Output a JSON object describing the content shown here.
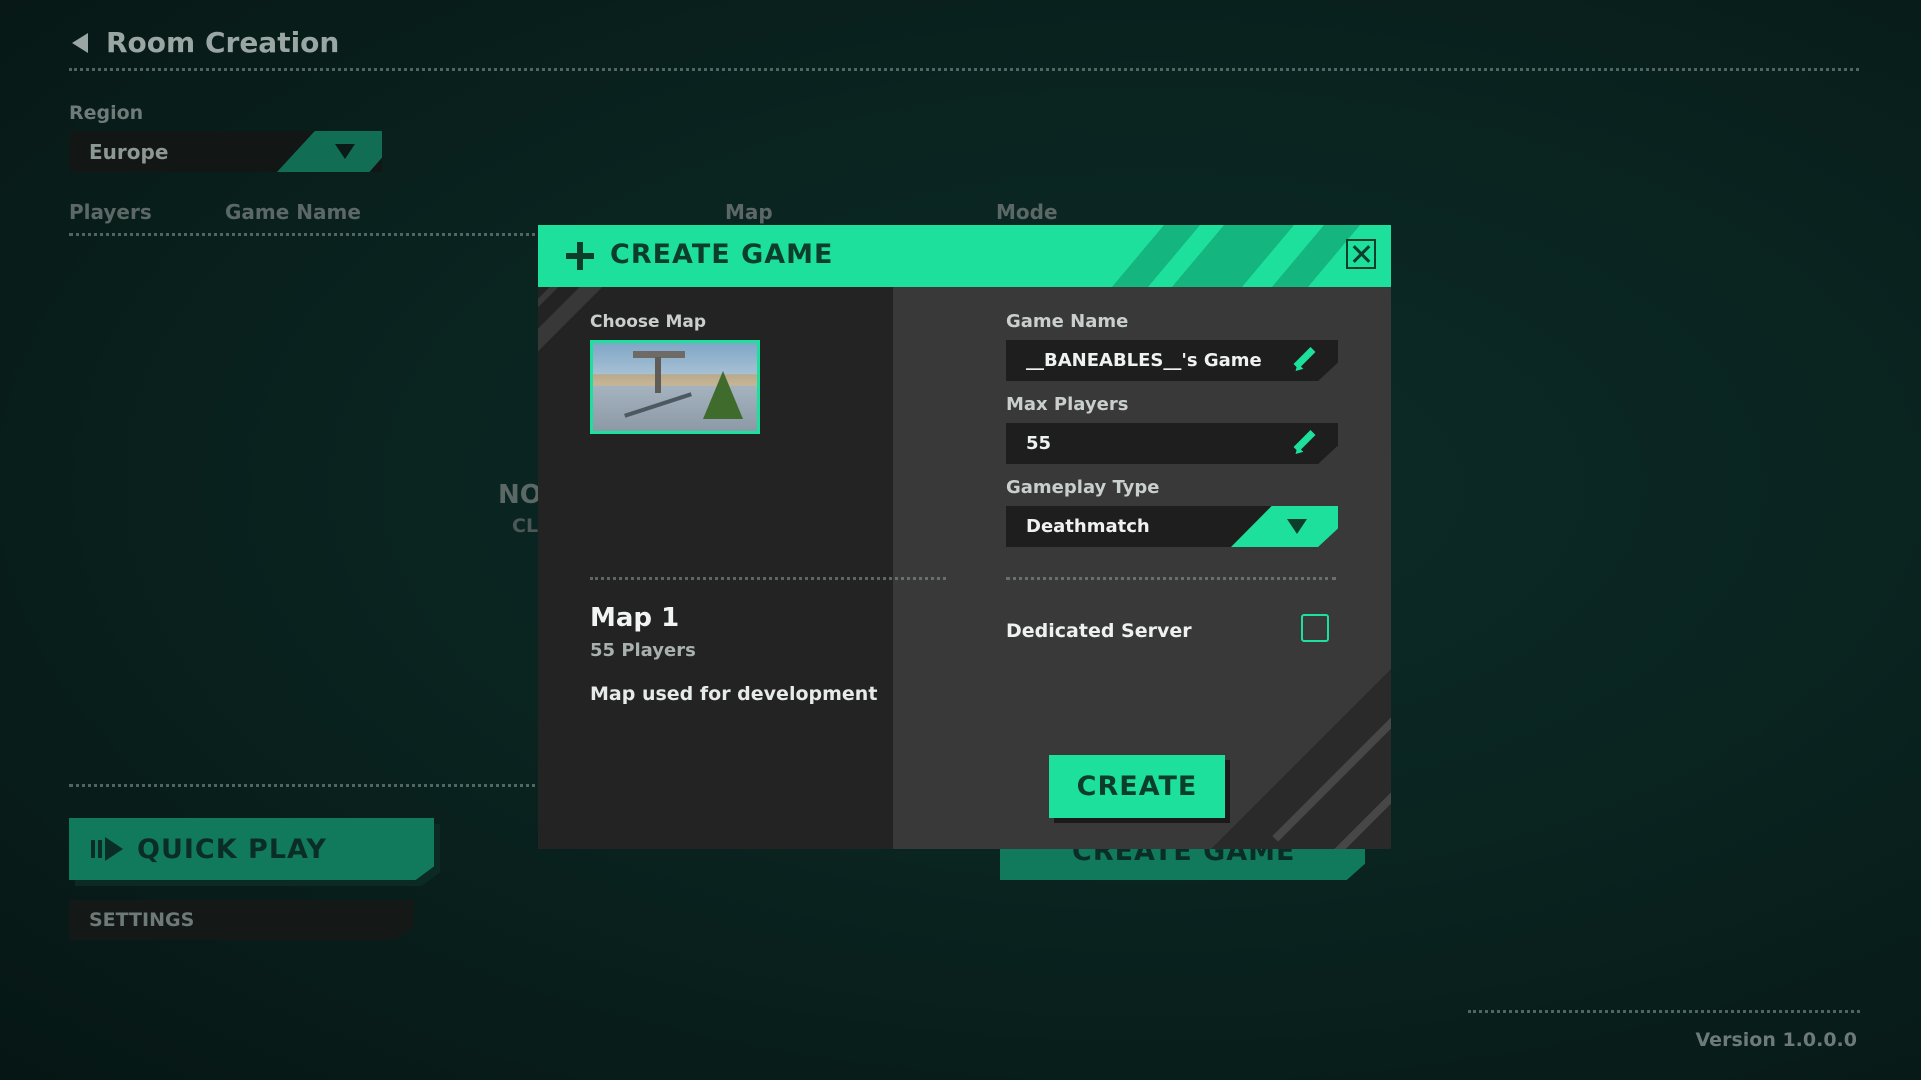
{
  "page": {
    "title": "Room Creation",
    "region_label": "Region",
    "region_value": "Europe",
    "columns": [
      "Players",
      "Game Name",
      "Map",
      "Mode"
    ],
    "empty_title": "NO",
    "empty_subtitle": "CL",
    "quick_play_label": "QUICK PLAY",
    "settings_label": "SETTINGS",
    "create_game_label": "CREATE GAME",
    "version": "Version 1.0.0.0"
  },
  "modal": {
    "title": "CREATE GAME",
    "choose_map_label": "Choose Map",
    "map": {
      "name": "Map 1",
      "players": "55 Players",
      "description": "Map used for development"
    },
    "game_name_label": "Game Name",
    "game_name_value": "__BANEABLES__'s Game",
    "max_players_label": "Max Players",
    "max_players_value": "55",
    "gameplay_type_label": "Gameplay Type",
    "gameplay_type_value": "Deathmatch",
    "dedicated_server_label": "Dedicated Server",
    "dedicated_server_checked": false,
    "create_label": "CREATE"
  },
  "colors": {
    "accent": "#1de09c",
    "accent_dark": "#117a5d",
    "background": "#0a2420"
  }
}
